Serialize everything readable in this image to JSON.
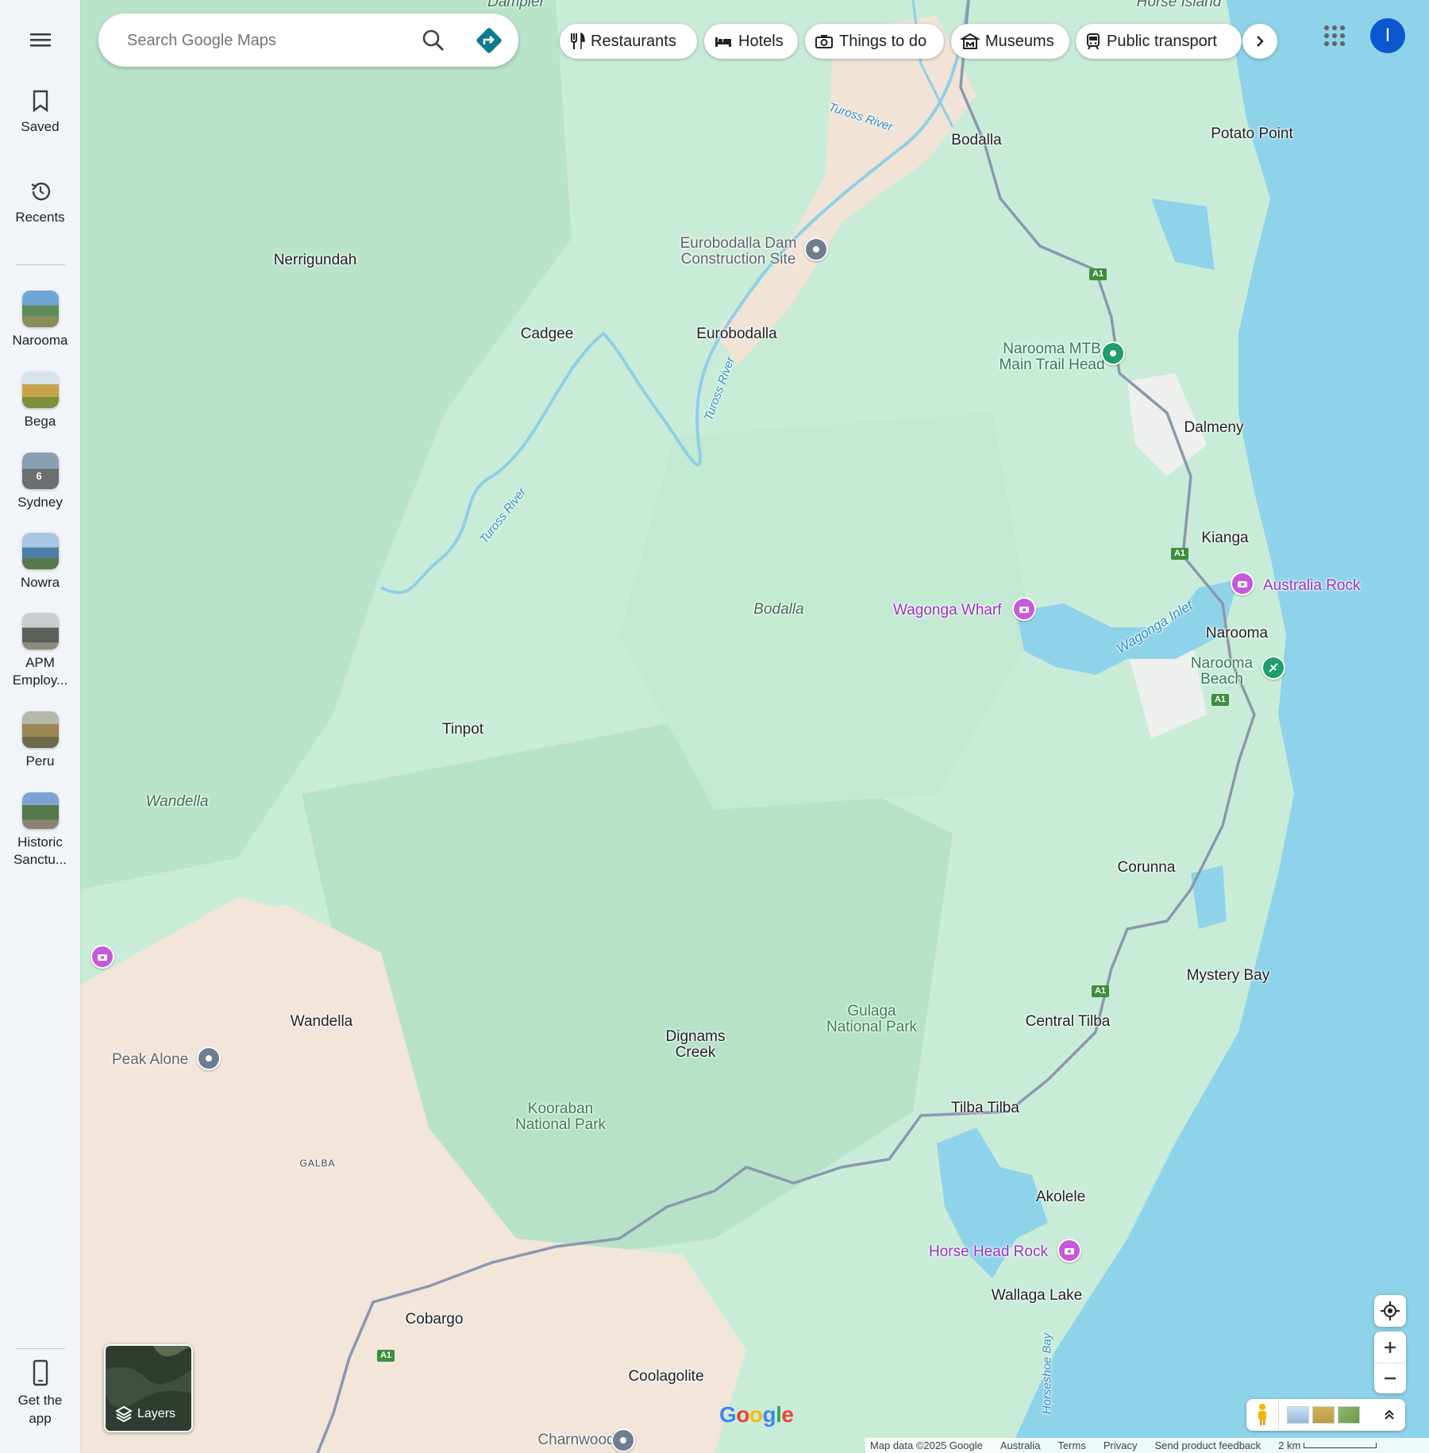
{
  "search": {
    "placeholder": "Search Google Maps"
  },
  "chips": [
    {
      "label": "Restaurants",
      "icon": "fork-knife-icon"
    },
    {
      "label": "Hotels",
      "icon": "bed-icon"
    },
    {
      "label": "Things to do",
      "icon": "camera-icon"
    },
    {
      "label": "Museums",
      "icon": "museum-icon"
    },
    {
      "label": "Public transport",
      "icon": "train-icon"
    }
  ],
  "account": {
    "initial": "I",
    "color": "#0b57d0"
  },
  "rail": {
    "saved": "Saved",
    "recents": "Recents",
    "recent_items": [
      {
        "label": "Narooma"
      },
      {
        "label": "Bega"
      },
      {
        "label": "Sydney",
        "badge": "6"
      },
      {
        "label": "Nowra"
      },
      {
        "label": "APM Employ..."
      },
      {
        "label": "Peru"
      },
      {
        "label": "Historic Sanctu..."
      }
    ],
    "get_app": "Get the app"
  },
  "map": {
    "places": {
      "bodalla": "Bodalla",
      "potato_point": "Potato Point",
      "nerrigundah": "Nerrigundah",
      "cadgee": "Cadgee",
      "eurobodalla": "Eurobodalla",
      "dalmeny": "Dalmeny",
      "kianga": "Kianga",
      "narooma": "Narooma",
      "tinpot": "Tinpot",
      "corunna": "Corunna",
      "mystery_bay": "Mystery Bay",
      "wandella": "Wandella",
      "central_tilba": "Central Tilba",
      "dignams_creek": "Dignams Creek",
      "tilba_tilba": "Tilba Tilba",
      "galba": "GALBA",
      "akolele": "Akolele",
      "wallaga_lake": "Wallaga Lake",
      "cobargo": "Cobargo",
      "coolagolite": "Coolagolite",
      "charnwood": "Charnwood",
      "dampier": "Dampier",
      "horse_island": "Horse Island"
    },
    "areas": {
      "bodalla_forest": "Bodalla",
      "wandella_forest": "Wandella",
      "gulaga": "Gulaga National Park",
      "kooraban": "Kooraban National Park"
    },
    "pois": {
      "dam_site": "Eurobodalla Dam Construction Site",
      "mtb": "Narooma MTB Main Trail Head",
      "narooma_beach": "Narooma Beach",
      "australia_rock": "Australia Rock",
      "wagonga_wharf": "Wagonga Wharf",
      "horse_head_rock": "Horse Head Rock",
      "peak_alone": "Peak Alone"
    },
    "water": {
      "tuross_1": "Tuross River",
      "tuross_2": "Tuross River",
      "tuross_3": "Tuross River",
      "wagonga_inlet": "Wagonga Inlet",
      "horseshoe_bay": "Horseshoe Bay"
    },
    "road_shield": "A1"
  },
  "controls": {
    "layers": "Layers"
  },
  "footer": {
    "map_data": "Map data ©2025 Google",
    "country": "Australia",
    "terms": "Terms",
    "privacy": "Privacy",
    "feedback": "Send product feedback",
    "scale": "2 km"
  },
  "logo": "Google",
  "colors": {
    "land": "#cfeedd",
    "forest": "#bfe6cf",
    "farmland": "#f3e6dc",
    "ocean": "#8fd3ea",
    "road": "#7a8ba0",
    "accent": "#0b57d0",
    "attraction": "#9334c6"
  }
}
